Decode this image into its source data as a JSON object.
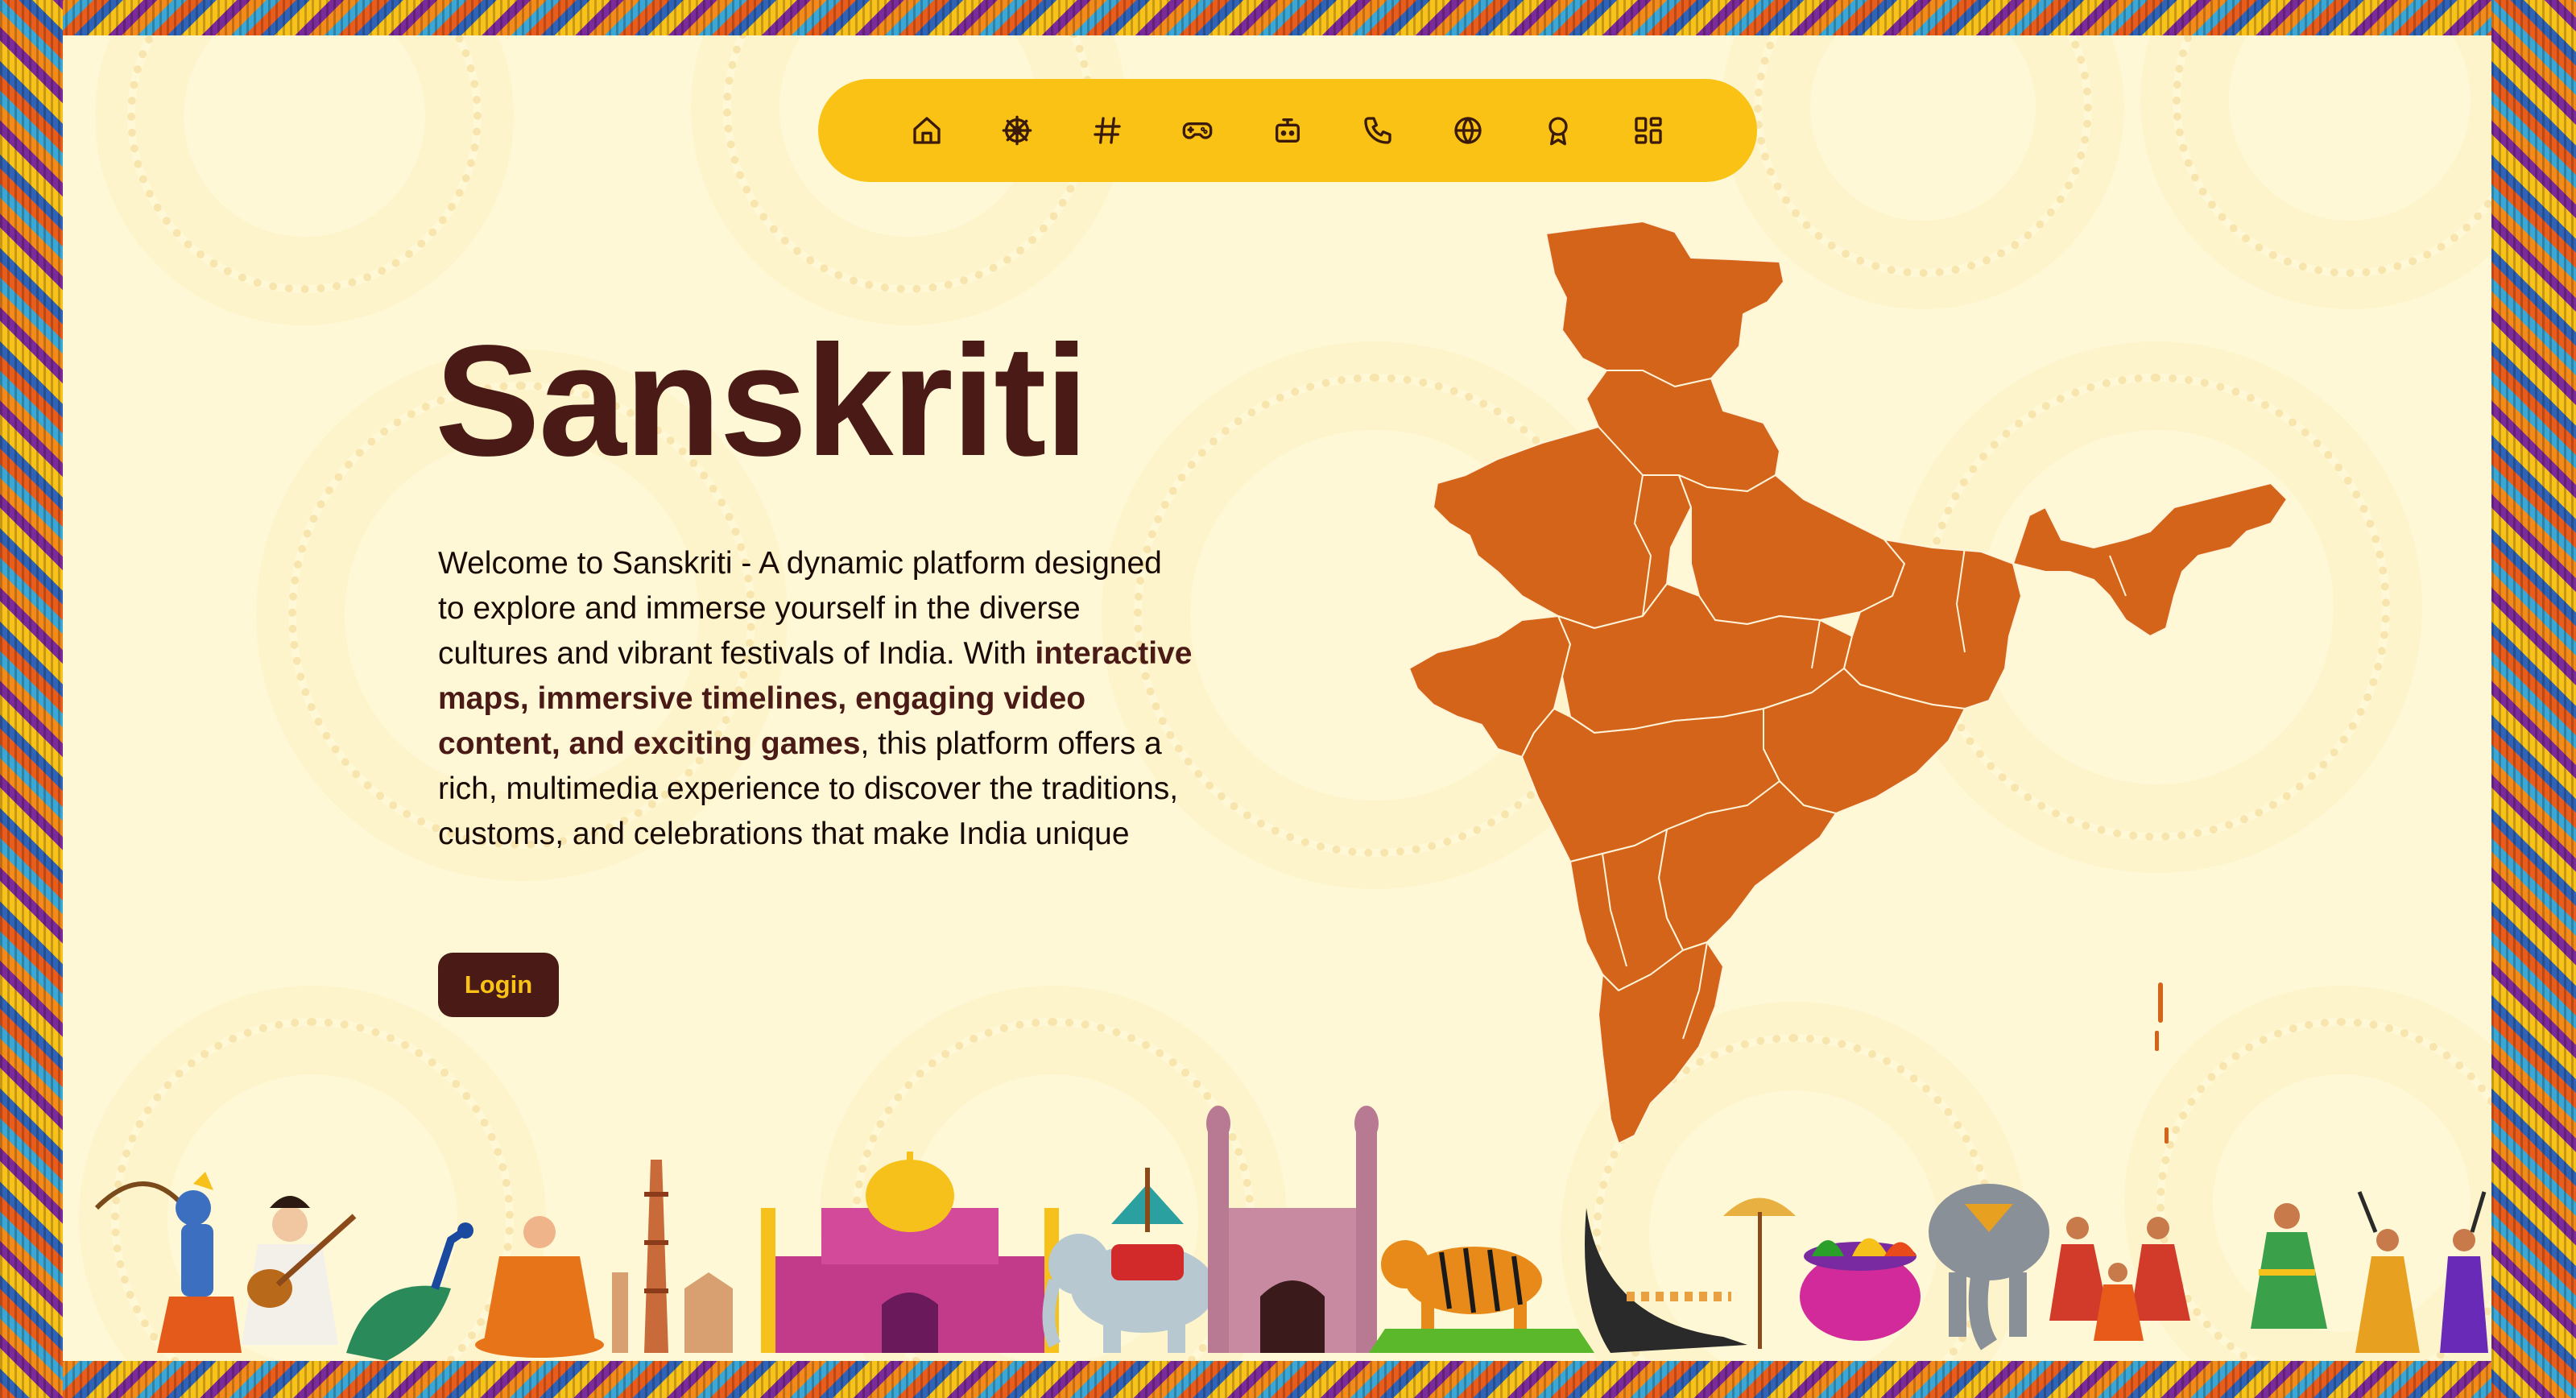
{
  "nav": {
    "items": [
      {
        "icon": "home-icon",
        "name": "home"
      },
      {
        "icon": "dharma-wheel-icon",
        "name": "culture"
      },
      {
        "icon": "hashtag-icon",
        "name": "trending"
      },
      {
        "icon": "gamepad-icon",
        "name": "games"
      },
      {
        "icon": "bot-icon",
        "name": "chatbot"
      },
      {
        "icon": "phone-icon",
        "name": "contact"
      },
      {
        "icon": "globe-icon",
        "name": "explore"
      },
      {
        "icon": "badge-icon",
        "name": "achievements"
      },
      {
        "icon": "dashboard-icon",
        "name": "dashboard"
      }
    ]
  },
  "hero": {
    "title": "Sanskriti",
    "desc_part1": "Welcome to Sanskriti - A dynamic platform designed to explore and immerse yourself in the diverse cultures and vibrant festivals of India. With ",
    "desc_bold": "interactive maps, immersive timelines, engaging video content, and exciting games",
    "desc_part2": ", this platform offers a rich, multimedia experience to discover the traditions, customs, and celebrations that make India unique",
    "login_label": "Login"
  },
  "colors": {
    "background": "#fff8d6",
    "nav": "#f9c215",
    "title": "#4a1a16",
    "map": "#d4641a",
    "button_bg": "#4a1a16",
    "button_text": "#f9c215"
  },
  "illustrations": [
    "archer-deity",
    "veena-goddess",
    "peacock",
    "buddha",
    "qutub-minar",
    "taj-mahal",
    "decorated-elephant",
    "charminar",
    "tiger",
    "snake-boat",
    "umbrella",
    "holi-colors",
    "elephant",
    "dancers",
    "folk-dancer",
    "dandiya-dancers"
  ]
}
